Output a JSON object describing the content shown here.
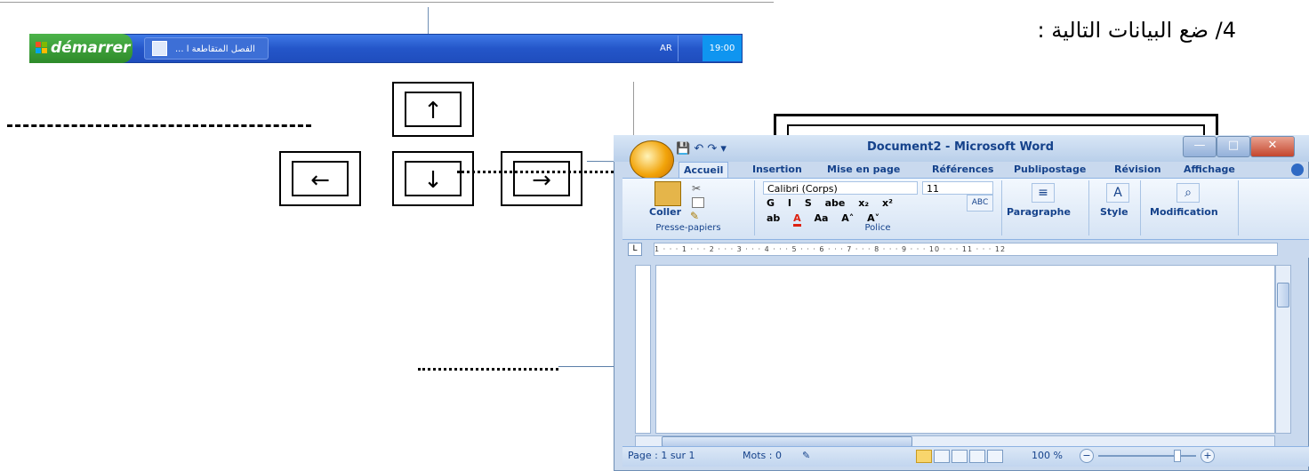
{
  "instruction": "4/ ضع البيانات التالية :",
  "taskbar": {
    "start_label": "démarrer",
    "task_label": "... الفصل المتقاطعة ا",
    "language": "AR",
    "clock": "19:00"
  },
  "arrow_keys": {
    "up": "↑",
    "left": "←",
    "down": "↓",
    "right": "→"
  },
  "word": {
    "title": "Document2 - Microsoft Word",
    "quick_access": "💾 ↶ ↷ ▾",
    "window_buttons": {
      "minimize": "—",
      "maximize": "□",
      "close": "✕"
    },
    "tabs": [
      "Accueil",
      "Insertion",
      "Mise en page",
      "Références",
      "Publipostage",
      "Révision",
      "Affichage"
    ],
    "clipboard": {
      "paste": "Coller",
      "group": "Presse-papiers"
    },
    "font": {
      "name": "Calibri (Corps)",
      "size": "11",
      "row1": [
        "G",
        "I",
        "S",
        "abe",
        "x₂",
        "x²"
      ],
      "row2": [
        "ab",
        "A",
        "Aa",
        "A˄",
        "A˅"
      ],
      "group": "Police"
    },
    "paragraph": "Paragraphe",
    "style": "Style",
    "modification": "Modification",
    "ruler": "1 · · · 1 · · · 2 · · · 3 · · · 4 · · · 5 · · · 6 · · · 7 · · · 8 · · · 9 · · · 10 · · · 11 · · · 12",
    "status": {
      "page": "Page : 1 sur 1",
      "words": "Mots : 0",
      "zoom": "100 %",
      "zoom_out": "−",
      "zoom_in": "+"
    }
  }
}
